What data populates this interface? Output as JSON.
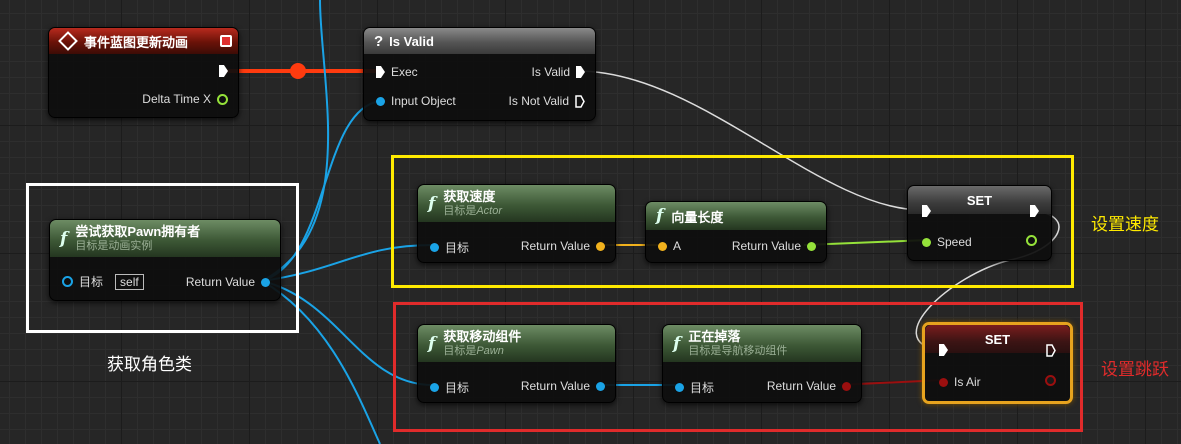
{
  "colors": {
    "exec": "#ffffff",
    "object_pin": "#1aa3e6",
    "float_pin": "#95e23a",
    "vector_pin": "#f2b21d",
    "bool_pin": "#9b0f0f",
    "exec_wire": "#ff3b0f",
    "yellow_comment": "#ffea00",
    "red_comment": "#e02b2b",
    "white_comment": "#ffffff"
  },
  "nodes": {
    "event": {
      "title": "事件蓝图更新动画",
      "icon": "event-diamond-icon",
      "delta": "Delta Time X"
    },
    "isvalid": {
      "title": "Is Valid",
      "icon": "question-icon",
      "exec": "Exec",
      "input_object": "Input Object",
      "is_valid": "Is Valid",
      "is_not_valid": "Is Not Valid"
    },
    "try_get_pawn": {
      "title": "尝试获取Pawn拥有者",
      "subtitle": "目标是动画实例",
      "target": "目标",
      "self": "self",
      "return": "Return Value"
    },
    "get_velocity": {
      "title": "获取速度",
      "subtitle_prefix": "目标是",
      "subtitle_class": "Actor",
      "target": "目标",
      "return": "Return Value"
    },
    "vector_length": {
      "title": "向量长度",
      "a": "A",
      "return": "Return Value"
    },
    "set_speed": {
      "title": "SET",
      "pin": "Speed"
    },
    "get_movement": {
      "title": "获取移动组件",
      "subtitle_prefix": "目标是",
      "subtitle_class": "Pawn",
      "target": "目标",
      "return": "Return Value"
    },
    "is_falling": {
      "title": "正在掉落",
      "subtitle": "目标是导航移动组件",
      "target": "目标",
      "return": "Return Value"
    },
    "set_isair": {
      "title": "SET",
      "pin": "Is Air"
    }
  },
  "comments": {
    "get_character_label": "获取角色类",
    "set_speed_label": "设置速度",
    "set_jump_label": "设置跳跃"
  }
}
